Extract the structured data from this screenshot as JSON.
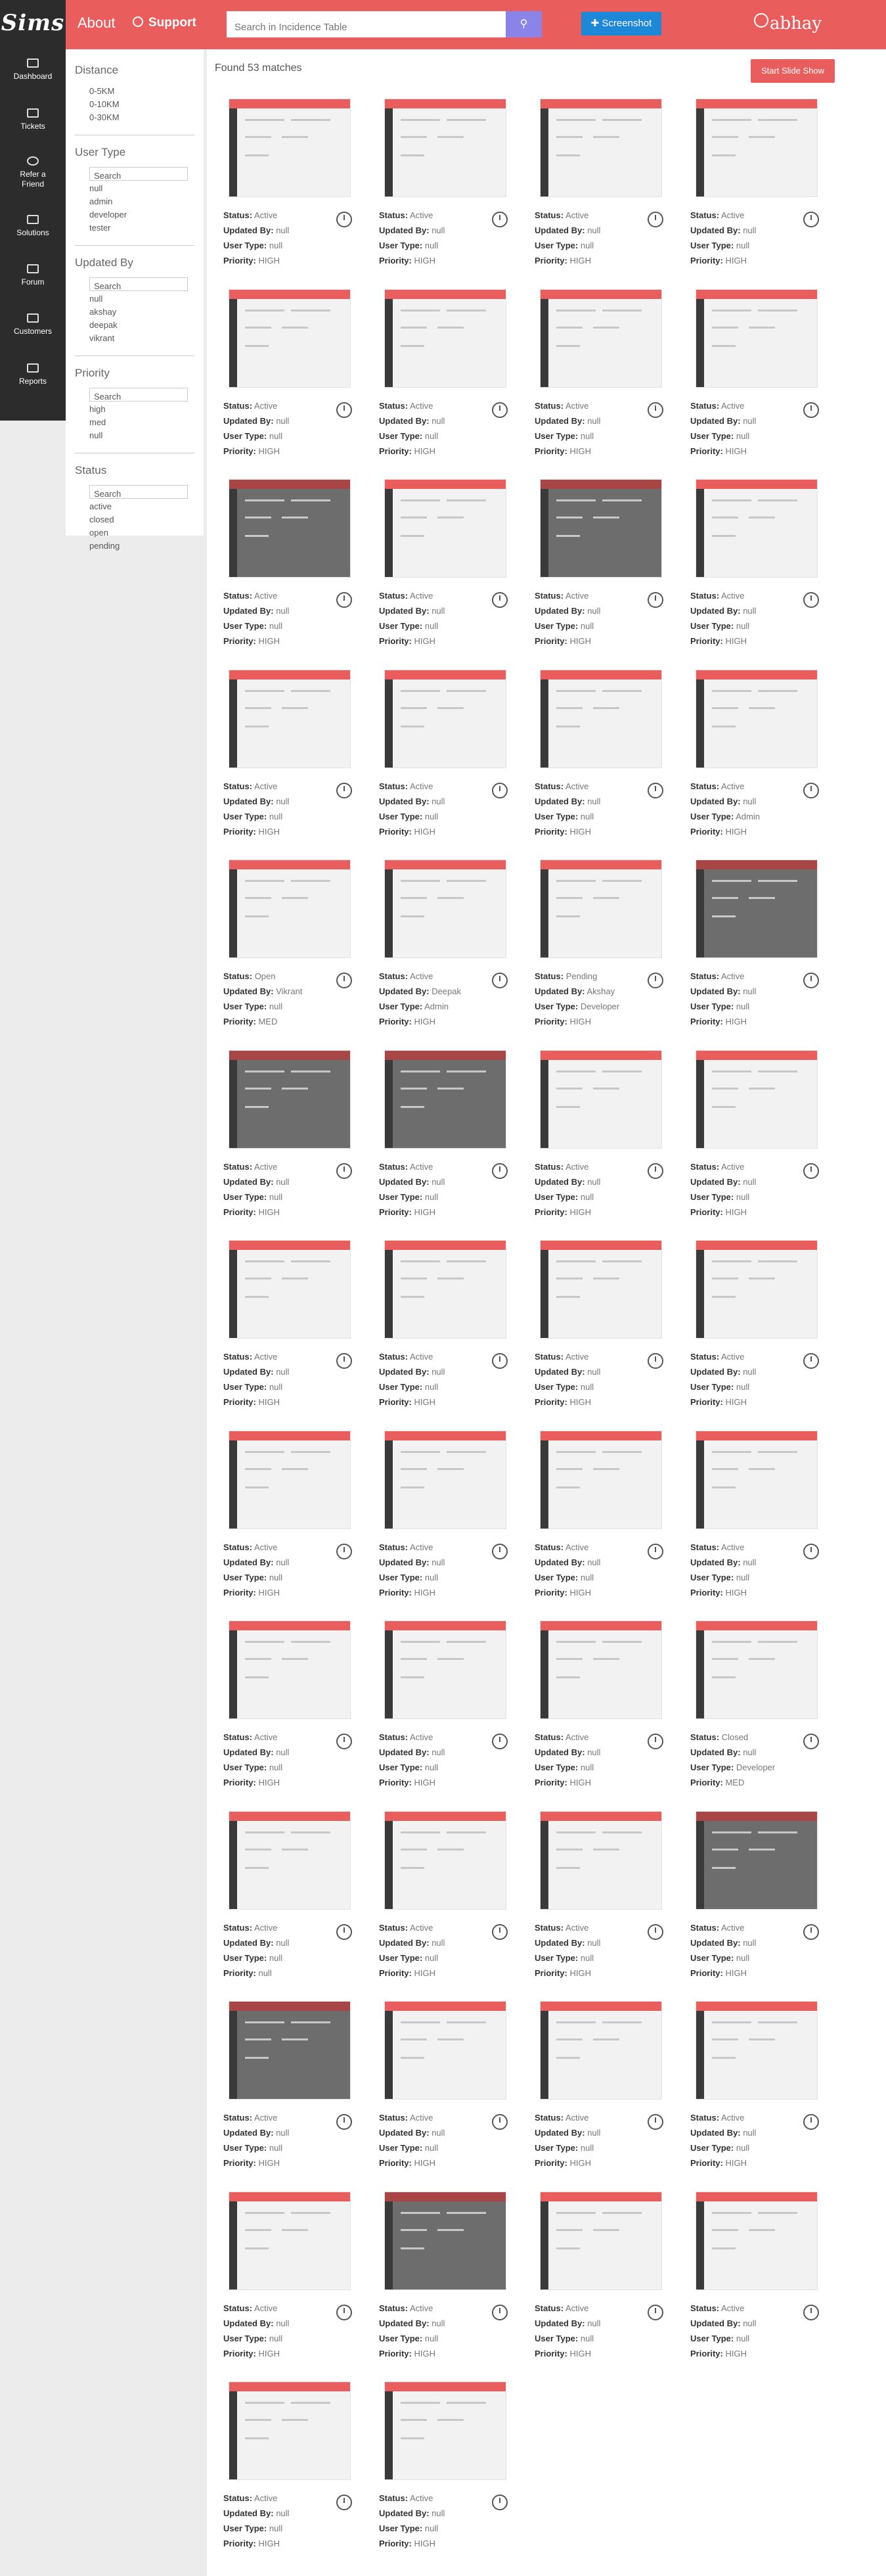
{
  "header": {
    "brand": "Sims",
    "about": "About",
    "support": "Support",
    "search_placeholder": "Search in Incidence Table",
    "screenshot": "Screenshot",
    "user": "abhay",
    "accent": "#e95d5d"
  },
  "rail": [
    {
      "label": "Dashboard",
      "icon": "monitor-icon"
    },
    {
      "label": "Tickets",
      "icon": "tag-icon"
    },
    {
      "label": "Refer a Friend",
      "icon": "globe-icon"
    },
    {
      "label": "Solutions",
      "icon": "pen-icon"
    },
    {
      "label": "Forum",
      "icon": "building-icon"
    },
    {
      "label": "Customers",
      "icon": "users-icon"
    },
    {
      "label": "Reports",
      "icon": "clipboard-icon"
    }
  ],
  "filters": {
    "distance": {
      "title": "Distance",
      "options": [
        "0-5KM",
        "0-10KM",
        "0-30KM"
      ]
    },
    "user_type": {
      "title": "User Type",
      "search": "Search",
      "options": [
        "null",
        "admin",
        "developer",
        "tester"
      ]
    },
    "updated_by": {
      "title": "Updated By",
      "search": "Search",
      "options": [
        "null",
        "akshay",
        "deepak",
        "vikrant"
      ]
    },
    "priority": {
      "title": "Priority",
      "search": "Search",
      "options": [
        "high",
        "med",
        "null"
      ]
    },
    "status": {
      "title": "Status",
      "search": "Search",
      "options": [
        "active",
        "closed",
        "open",
        "pending"
      ]
    }
  },
  "results": {
    "found": "Found 53 matches",
    "slideshow": "Start Slide Show",
    "labels": {
      "status": "Status:",
      "updated_by": "Updated By:",
      "user_type": "User Type:",
      "priority": "Priority:"
    },
    "items": [
      {
        "status": "Active",
        "updated_by": "null",
        "user_type": "null",
        "priority": "HIGH",
        "dark": false
      },
      {
        "status": "Active",
        "updated_by": "null",
        "user_type": "null",
        "priority": "HIGH",
        "dark": false
      },
      {
        "status": "Active",
        "updated_by": "null",
        "user_type": "null",
        "priority": "HIGH",
        "dark": false
      },
      {
        "status": "Active",
        "updated_by": "null",
        "user_type": "null",
        "priority": "HIGH",
        "dark": false
      },
      {
        "status": "Active",
        "updated_by": "null",
        "user_type": "null",
        "priority": "HIGH",
        "dark": false
      },
      {
        "status": "Active",
        "updated_by": "null",
        "user_type": "null",
        "priority": "HIGH",
        "dark": false
      },
      {
        "status": "Active",
        "updated_by": "null",
        "user_type": "null",
        "priority": "HIGH",
        "dark": false
      },
      {
        "status": "Active",
        "updated_by": "null",
        "user_type": "null",
        "priority": "HIGH",
        "dark": false
      },
      {
        "status": "Active",
        "updated_by": "null",
        "user_type": "null",
        "priority": "HIGH",
        "dark": true
      },
      {
        "status": "Active",
        "updated_by": "null",
        "user_type": "null",
        "priority": "HIGH",
        "dark": false
      },
      {
        "status": "Active",
        "updated_by": "null",
        "user_type": "null",
        "priority": "HIGH",
        "dark": true
      },
      {
        "status": "Active",
        "updated_by": "null",
        "user_type": "null",
        "priority": "HIGH",
        "dark": false
      },
      {
        "status": "Active",
        "updated_by": "null",
        "user_type": "null",
        "priority": "HIGH",
        "dark": false
      },
      {
        "status": "Active",
        "updated_by": "null",
        "user_type": "null",
        "priority": "HIGH",
        "dark": false
      },
      {
        "status": "Active",
        "updated_by": "null",
        "user_type": "null",
        "priority": "HIGH",
        "dark": false
      },
      {
        "status": "Active",
        "updated_by": "null",
        "user_type": "Admin",
        "priority": "HIGH",
        "dark": false
      },
      {
        "status": "Open",
        "updated_by": "Vikrant",
        "user_type": "null",
        "priority": "MED",
        "dark": false
      },
      {
        "status": "Active",
        "updated_by": "Deepak",
        "user_type": "Admin",
        "priority": "HIGH",
        "dark": false
      },
      {
        "status": "Pending",
        "updated_by": "Akshay",
        "user_type": "Developer",
        "priority": "HIGH",
        "dark": false
      },
      {
        "status": "Active",
        "updated_by": "null",
        "user_type": "null",
        "priority": "HIGH",
        "dark": true
      },
      {
        "status": "Active",
        "updated_by": "null",
        "user_type": "null",
        "priority": "HIGH",
        "dark": true
      },
      {
        "status": "Active",
        "updated_by": "null",
        "user_type": "null",
        "priority": "HIGH",
        "dark": true
      },
      {
        "status": "Active",
        "updated_by": "null",
        "user_type": "null",
        "priority": "HIGH",
        "dark": false
      },
      {
        "status": "Active",
        "updated_by": "null",
        "user_type": "null",
        "priority": "HIGH",
        "dark": false
      },
      {
        "status": "Active",
        "updated_by": "null",
        "user_type": "null",
        "priority": "HIGH",
        "dark": false
      },
      {
        "status": "Active",
        "updated_by": "null",
        "user_type": "null",
        "priority": "HIGH",
        "dark": false
      },
      {
        "status": "Active",
        "updated_by": "null",
        "user_type": "null",
        "priority": "HIGH",
        "dark": false
      },
      {
        "status": "Active",
        "updated_by": "null",
        "user_type": "null",
        "priority": "HIGH",
        "dark": false
      },
      {
        "status": "Active",
        "updated_by": "null",
        "user_type": "null",
        "priority": "HIGH",
        "dark": false
      },
      {
        "status": "Active",
        "updated_by": "null",
        "user_type": "null",
        "priority": "HIGH",
        "dark": false
      },
      {
        "status": "Active",
        "updated_by": "null",
        "user_type": "null",
        "priority": "HIGH",
        "dark": false
      },
      {
        "status": "Active",
        "updated_by": "null",
        "user_type": "null",
        "priority": "HIGH",
        "dark": false
      },
      {
        "status": "Active",
        "updated_by": "null",
        "user_type": "null",
        "priority": "HIGH",
        "dark": false
      },
      {
        "status": "Active",
        "updated_by": "null",
        "user_type": "null",
        "priority": "HIGH",
        "dark": false
      },
      {
        "status": "Active",
        "updated_by": "null",
        "user_type": "null",
        "priority": "HIGH",
        "dark": false
      },
      {
        "status": "Closed",
        "updated_by": "null",
        "user_type": "Developer",
        "priority": "MED",
        "dark": false
      },
      {
        "status": "Active",
        "updated_by": "null",
        "user_type": "null",
        "priority": "null",
        "dark": false
      },
      {
        "status": "Active",
        "updated_by": "null",
        "user_type": "null",
        "priority": "HIGH",
        "dark": false
      },
      {
        "status": "Active",
        "updated_by": "null",
        "user_type": "null",
        "priority": "HIGH",
        "dark": false
      },
      {
        "status": "Active",
        "updated_by": "null",
        "user_type": "null",
        "priority": "HIGH",
        "dark": true
      },
      {
        "status": "Active",
        "updated_by": "null",
        "user_type": "null",
        "priority": "HIGH",
        "dark": true
      },
      {
        "status": "Active",
        "updated_by": "null",
        "user_type": "null",
        "priority": "HIGH",
        "dark": false
      },
      {
        "status": "Active",
        "updated_by": "null",
        "user_type": "null",
        "priority": "HIGH",
        "dark": false
      },
      {
        "status": "Active",
        "updated_by": "null",
        "user_type": "null",
        "priority": "HIGH",
        "dark": false
      },
      {
        "status": "Active",
        "updated_by": "null",
        "user_type": "null",
        "priority": "HIGH",
        "dark": false
      },
      {
        "status": "Active",
        "updated_by": "null",
        "user_type": "null",
        "priority": "HIGH",
        "dark": true
      },
      {
        "status": "Active",
        "updated_by": "null",
        "user_type": "null",
        "priority": "HIGH",
        "dark": false
      },
      {
        "status": "Active",
        "updated_by": "null",
        "user_type": "null",
        "priority": "HIGH",
        "dark": false
      },
      {
        "status": "Active",
        "updated_by": "null",
        "user_type": "null",
        "priority": "HIGH",
        "dark": false
      },
      {
        "status": "Active",
        "updated_by": "null",
        "user_type": "null",
        "priority": "HIGH",
        "dark": false
      }
    ]
  }
}
